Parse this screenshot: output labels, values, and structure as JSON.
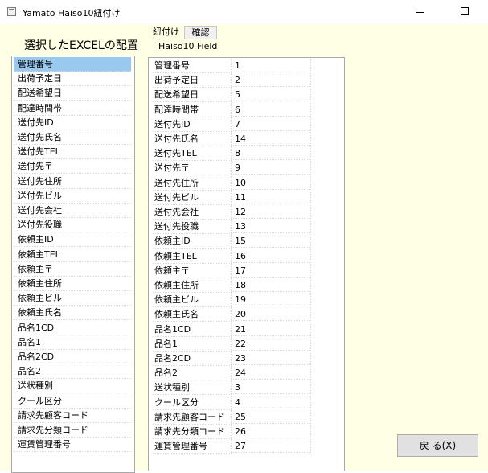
{
  "window": {
    "title": "Yamato Haiso10紐付け",
    "icon": "app-window-icon"
  },
  "left_panel": {
    "heading": "選択したEXCELの配置",
    "items": [
      "管理番号",
      "出荷予定日",
      "配送希望日",
      "配達時間帯",
      "送付先ID",
      "送付先氏名",
      "送付先TEL",
      "送付先〒",
      "送付先住所",
      "送付先ビル",
      "送付先会社",
      "送付先役職",
      "依頼主ID",
      "依頼主TEL",
      "依頼主〒",
      "依頼主住所",
      "依頼主ビル",
      "依頼主氏名",
      "品名1CD",
      "品名1",
      "品名2CD",
      "品名2",
      "送状種別",
      "クール区分",
      "請求先顧客コード",
      "請求先分類コード",
      "運賃管理番号"
    ],
    "selected_index": 0
  },
  "tabs": [
    {
      "label": "紐付け",
      "active": true
    },
    {
      "label": "確認",
      "active": false
    }
  ],
  "mapping": {
    "header": "Haiso10  Field",
    "rows": [
      {
        "name": "管理番号",
        "field": "1"
      },
      {
        "name": "出荷予定日",
        "field": "2"
      },
      {
        "name": "配送希望日",
        "field": "5"
      },
      {
        "name": "配達時間帯",
        "field": "6"
      },
      {
        "name": "送付先ID",
        "field": "7"
      },
      {
        "name": "送付先氏名",
        "field": "14"
      },
      {
        "name": "送付先TEL",
        "field": "8"
      },
      {
        "name": "送付先〒",
        "field": "9"
      },
      {
        "name": "送付先住所",
        "field": "10"
      },
      {
        "name": "送付先ビル",
        "field": "11"
      },
      {
        "name": "送付先会社",
        "field": "12"
      },
      {
        "name": "送付先役職",
        "field": "13"
      },
      {
        "name": "依頼主ID",
        "field": "15"
      },
      {
        "name": "依頼主TEL",
        "field": "16"
      },
      {
        "name": "依頼主〒",
        "field": "17"
      },
      {
        "name": "依頼主住所",
        "field": "18"
      },
      {
        "name": "依頼主ビル",
        "field": "19"
      },
      {
        "name": "依頼主氏名",
        "field": "20"
      },
      {
        "name": "品名1CD",
        "field": "21"
      },
      {
        "name": "品名1",
        "field": "22"
      },
      {
        "name": "品名2CD",
        "field": "23"
      },
      {
        "name": "品名2",
        "field": "24"
      },
      {
        "name": "送状種別",
        "field": "3"
      },
      {
        "name": "クール区分",
        "field": "4"
      },
      {
        "name": "請求先顧客コード",
        "field": "25"
      },
      {
        "name": "請求先分類コード",
        "field": "26"
      },
      {
        "name": "運賃管理番号",
        "field": "27"
      }
    ]
  },
  "buttons": {
    "back_label": "戻 る(X)"
  },
  "colors": {
    "form_background": "#ffffe6",
    "selection": "#99c9ef",
    "button_face": "#e1e1e1"
  }
}
